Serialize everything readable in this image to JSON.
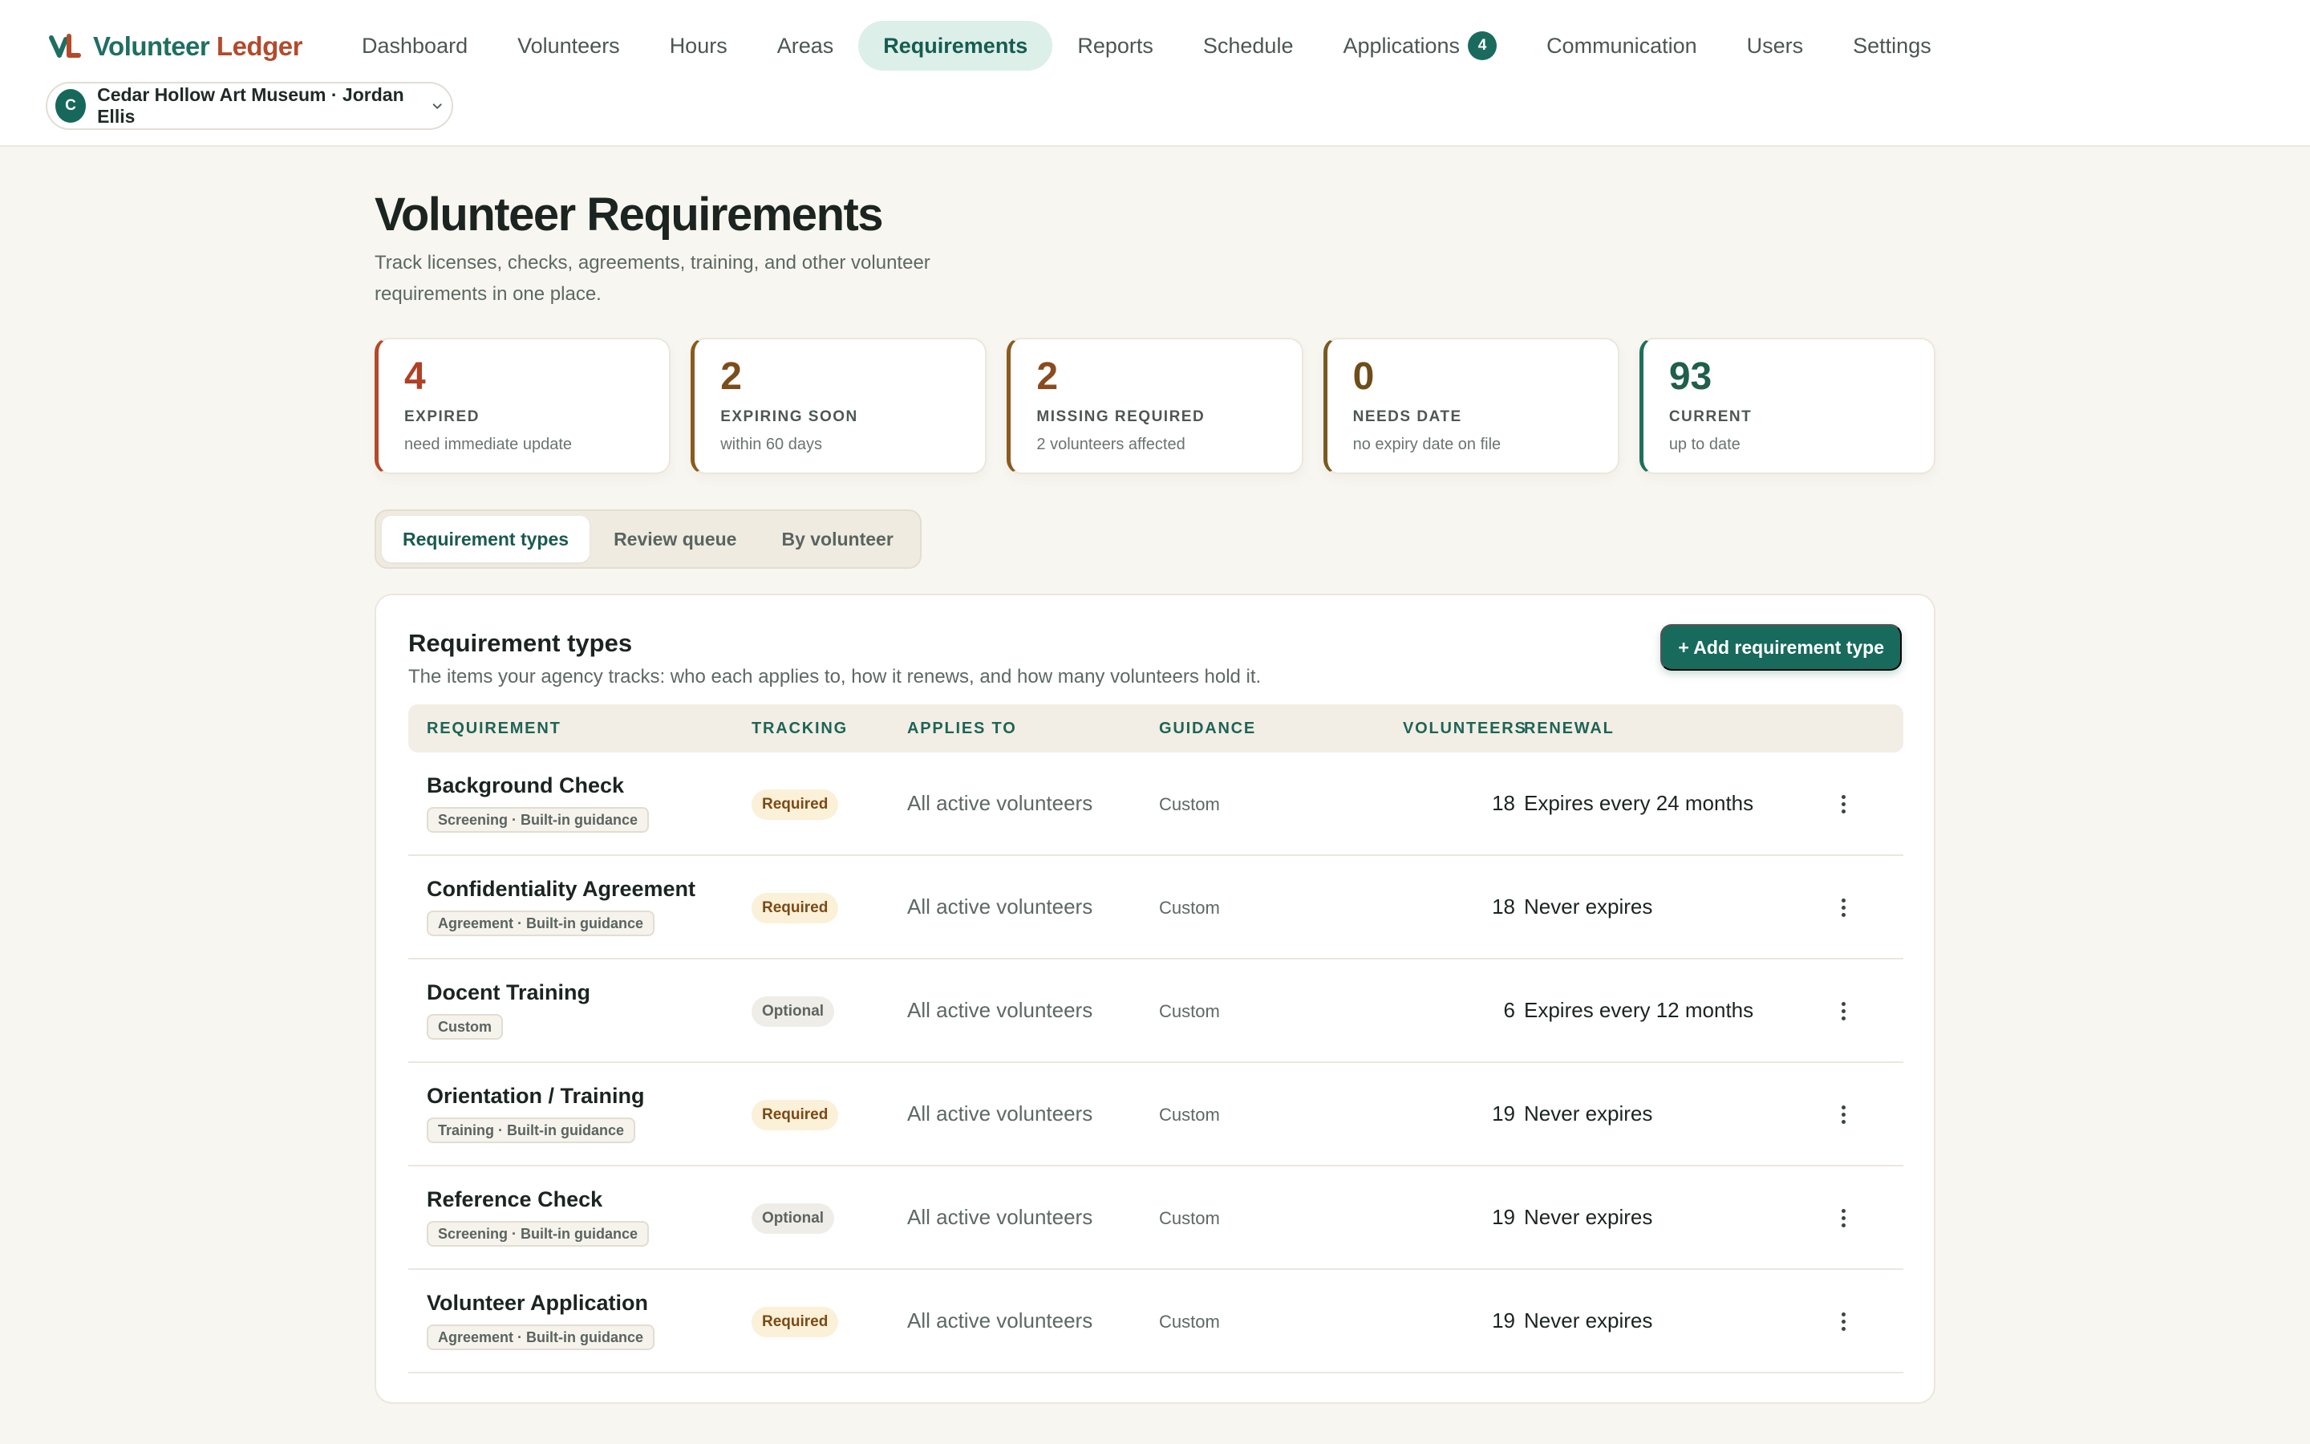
{
  "app": {
    "brand_first": "Volunteer",
    "brand_second": "Ledger",
    "accent": "#1a6b5e",
    "warn": "#b5482a"
  },
  "nav": {
    "items": [
      {
        "label": "Dashboard"
      },
      {
        "label": "Volunteers"
      },
      {
        "label": "Hours"
      },
      {
        "label": "Areas"
      },
      {
        "label": "Requirements",
        "active": true
      },
      {
        "label": "Reports"
      },
      {
        "label": "Schedule"
      },
      {
        "label": "Applications",
        "badge": "4"
      },
      {
        "label": "Communication"
      },
      {
        "label": "Users"
      },
      {
        "label": "Settings"
      }
    ]
  },
  "org": {
    "avatar": "C",
    "label": "Cedar Hollow Art Museum · Jordan Ellis",
    "icon": "chevron-down-icon"
  },
  "page": {
    "title": "Volunteer Requirements",
    "subtitle": "Track licenses, checks, agreements, training, and other volunteer requirements in one place."
  },
  "stats": [
    {
      "value": "4",
      "label": "EXPIRED",
      "hint": "need immediate update"
    },
    {
      "value": "2",
      "label": "EXPIRING SOON",
      "hint": "within 60 days"
    },
    {
      "value": "2",
      "label": "MISSING REQUIRED",
      "hint": "2 volunteers affected"
    },
    {
      "value": "0",
      "label": "NEEDS DATE",
      "hint": "no expiry date on file"
    },
    {
      "value": "93",
      "label": "CURRENT",
      "hint": "up to date"
    }
  ],
  "tabs": [
    {
      "label": "Requirement types",
      "active": true
    },
    {
      "label": "Review queue"
    },
    {
      "label": "By volunteer"
    }
  ],
  "card": {
    "title": "Requirement types",
    "subtitle": "The items your agency tracks: who each applies to, how it renews, and how many volunteers hold it.",
    "add_button": "+ Add requirement type"
  },
  "table": {
    "columns": {
      "requirement": "REQUIREMENT",
      "tracking": "TRACKING",
      "applies_to": "APPLIES TO",
      "guidance": "GUIDANCE",
      "volunteers": "VOLUNTEERS",
      "renewal": "RENEWAL"
    },
    "rows": [
      {
        "name": "Background Check",
        "tag": "Screening · Built-in guidance",
        "tracking": "Required",
        "applies": "All active volunteers",
        "guidance": "Custom",
        "volunteers": "18",
        "renewal": "Expires every 24 months"
      },
      {
        "name": "Confidentiality Agreement",
        "tag": "Agreement · Built-in guidance",
        "tracking": "Required",
        "applies": "All active volunteers",
        "guidance": "Custom",
        "volunteers": "18",
        "renewal": "Never expires"
      },
      {
        "name": "Docent Training",
        "tag": "Custom",
        "tracking": "Optional",
        "applies": "All active volunteers",
        "guidance": "Custom",
        "volunteers": "6",
        "renewal": "Expires every 12 months"
      },
      {
        "name": "Orientation / Training",
        "tag": "Training · Built-in guidance",
        "tracking": "Required",
        "applies": "All active volunteers",
        "guidance": "Custom",
        "volunteers": "19",
        "renewal": "Never expires"
      },
      {
        "name": "Reference Check",
        "tag": "Screening · Built-in guidance",
        "tracking": "Optional",
        "applies": "All active volunteers",
        "guidance": "Custom",
        "volunteers": "19",
        "renewal": "Never expires"
      },
      {
        "name": "Volunteer Application",
        "tag": "Agreement · Built-in guidance",
        "tracking": "Required",
        "applies": "All active volunteers",
        "guidance": "Custom",
        "volunteers": "19",
        "renewal": "Never expires"
      }
    ]
  }
}
